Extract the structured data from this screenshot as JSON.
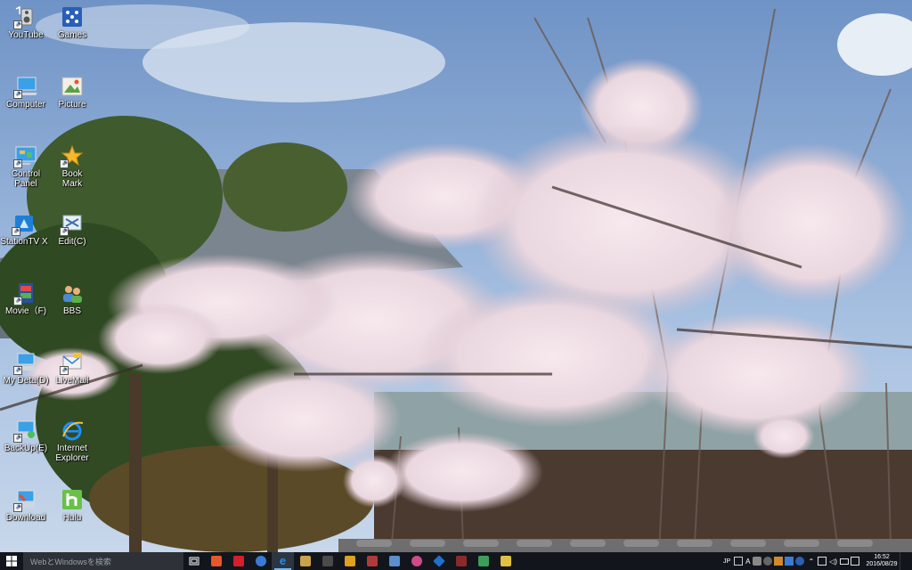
{
  "desktop": {
    "icons": [
      {
        "label": "YouTube",
        "icon": "speaker-icon"
      },
      {
        "label": "Games",
        "icon": "games-icon"
      },
      {
        "label": "Computer",
        "icon": "computer-icon"
      },
      {
        "label": "Picture",
        "icon": "picture-icon"
      },
      {
        "label": "Control\nPanel",
        "icon": "control-panel-icon"
      },
      {
        "label": "Book\nMark",
        "icon": "star-icon"
      },
      {
        "label": "StationTV X",
        "icon": "stationtv-icon"
      },
      {
        "label": "Edit(C)",
        "icon": "edit-icon"
      },
      {
        "label": "Movie（F)",
        "icon": "movie-icon"
      },
      {
        "label": "BBS",
        "icon": "people-icon"
      },
      {
        "label": "My Deta(D)",
        "icon": "drive-icon"
      },
      {
        "label": "LiveMail",
        "icon": "mail-icon"
      },
      {
        "label": "BackUp(E)",
        "icon": "backup-icon"
      },
      {
        "label": "Internet\nExplorer",
        "icon": "ie-icon"
      },
      {
        "label": "Download",
        "icon": "download-icon"
      },
      {
        "label": "Hulu",
        "icon": "hulu-icon"
      }
    ]
  },
  "taskbar": {
    "search_placeholder": "WebとWindowsを検索",
    "apps": [
      {
        "name": "taskbar-app-1",
        "color": "#e8572a"
      },
      {
        "name": "taskbar-app-2",
        "color": "#d4202a"
      },
      {
        "name": "taskbar-app-3",
        "color": "#3a7bd5"
      },
      {
        "name": "taskbar-app-ie",
        "color": "#1e90ff"
      },
      {
        "name": "taskbar-app-5",
        "color": "#c9a24a"
      },
      {
        "name": "taskbar-app-6",
        "color": "#4a4a4a"
      },
      {
        "name": "taskbar-app-7",
        "color": "#e0a020"
      },
      {
        "name": "taskbar-app-8",
        "color": "#b03a3a"
      },
      {
        "name": "taskbar-app-9",
        "color": "#5a8fd0"
      },
      {
        "name": "taskbar-app-10",
        "color": "#d04a8a"
      },
      {
        "name": "taskbar-app-11",
        "color": "#1f6fd0"
      },
      {
        "name": "taskbar-app-12",
        "color": "#8a2a2a"
      },
      {
        "name": "taskbar-app-13",
        "color": "#3aa05a"
      },
      {
        "name": "taskbar-app-14",
        "color": "#e0c040"
      }
    ],
    "tray_lang": "JP",
    "tray_ime": "A",
    "clock_time": "16:52",
    "clock_date": "2016/08/29"
  }
}
